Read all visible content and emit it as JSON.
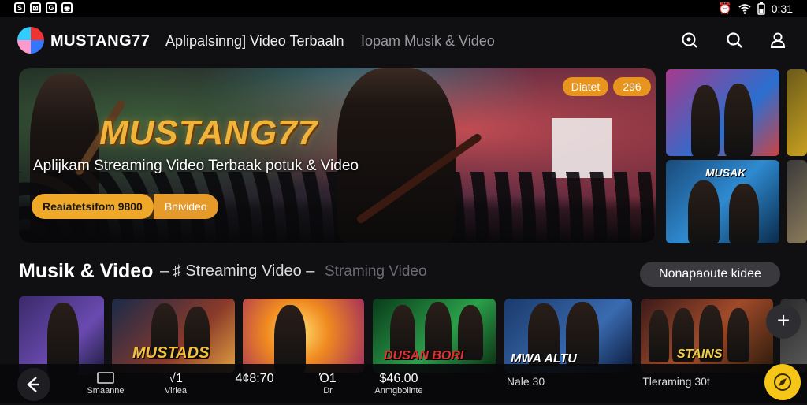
{
  "status_bar": {
    "left_icons": [
      "S",
      "⊠",
      "G",
      "◉"
    ],
    "time": "0:31"
  },
  "header": {
    "brand": "MUSTANG77",
    "nav_primary": "Aplipalsinng] Video Terbaaln",
    "nav_secondary": "Iopam Musik & Video",
    "icons": [
      "explore-icon",
      "search-icon",
      "profile-icon"
    ]
  },
  "hero": {
    "title": "MUSTANG77",
    "subtitle": "Aplijkam Streaming Video Terbaak potuk & Video",
    "primary_button": "Reaiatetsifom 9800",
    "secondary_button": "Bnivideo",
    "badge_left": "Diatet",
    "badge_right": "296"
  },
  "side_thumbs": [
    {
      "caption": ""
    },
    {
      "caption": "MUSAK"
    }
  ],
  "section": {
    "title": "Musik & Video",
    "sub_active": "– ♯ Streaming Video –",
    "sub_inactive": "Straming Video",
    "button": "Nonapaoute kidee"
  },
  "row_thumbs": [
    {
      "caption": ""
    },
    {
      "caption": "MUSTADS"
    },
    {
      "caption": ""
    },
    {
      "caption": "DUSAN BORI"
    },
    {
      "caption": "MWA ALTU"
    },
    {
      "caption": "STAINS"
    }
  ],
  "bottom_bar": [
    {
      "top": "",
      "label": "Smaanne"
    },
    {
      "top": "√1",
      "label": "Virlea"
    },
    {
      "top": "4¢8:70",
      "label": ""
    },
    {
      "top": "Ό1",
      "label": "Dr"
    },
    {
      "top": "$46.00",
      "label": "Anmgbolinte"
    },
    {
      "top": "Nale 30",
      "label": ""
    },
    {
      "top": "Tleraming 30t",
      "label": ""
    }
  ],
  "fab_plus": "+"
}
